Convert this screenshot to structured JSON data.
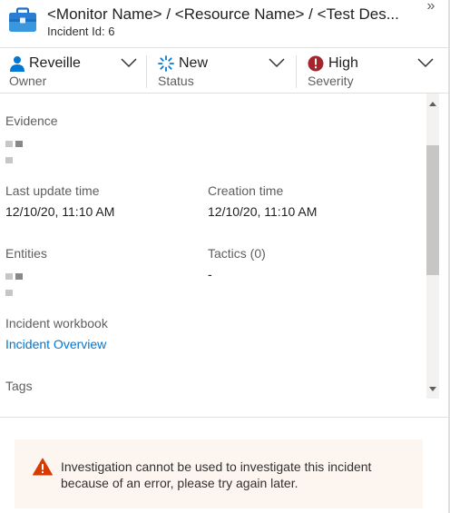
{
  "header": {
    "title": "<Monitor Name> / <Resource Name> / <Test Des...",
    "subtitle": "Incident Id: 6",
    "expand_glyph": "»",
    "icon": "briefcase-icon"
  },
  "status_bar": {
    "owner": {
      "value": "Reveille",
      "label": "Owner",
      "icon": "user-icon"
    },
    "status": {
      "value": "New",
      "label": "Status",
      "icon": "spinner-icon"
    },
    "severity": {
      "value": "High",
      "label": "Severity",
      "icon": "error-icon",
      "color": "#a4262c"
    }
  },
  "details": {
    "evidence_label": "Evidence",
    "last_update_label": "Last update time",
    "last_update_value": "12/10/20, 11:10 AM",
    "creation_label": "Creation time",
    "creation_value": "12/10/20, 11:10 AM",
    "entities_label": "Entities",
    "tactics_label": "Tactics (0)",
    "tactics_value": "-",
    "workbook_label": "Incident workbook",
    "workbook_link": "Incident Overview",
    "tags_label": "Tags"
  },
  "message": {
    "text": "Investigation cannot be used to investigate this incident because of an error, please try again later.",
    "icon": "warning-icon",
    "color": "#d83b01"
  },
  "colors": {
    "accent": "#0078d4",
    "owner_icon": "#0078d4",
    "status_icon": "#0078d4",
    "briefcase": "#2b88d8"
  }
}
